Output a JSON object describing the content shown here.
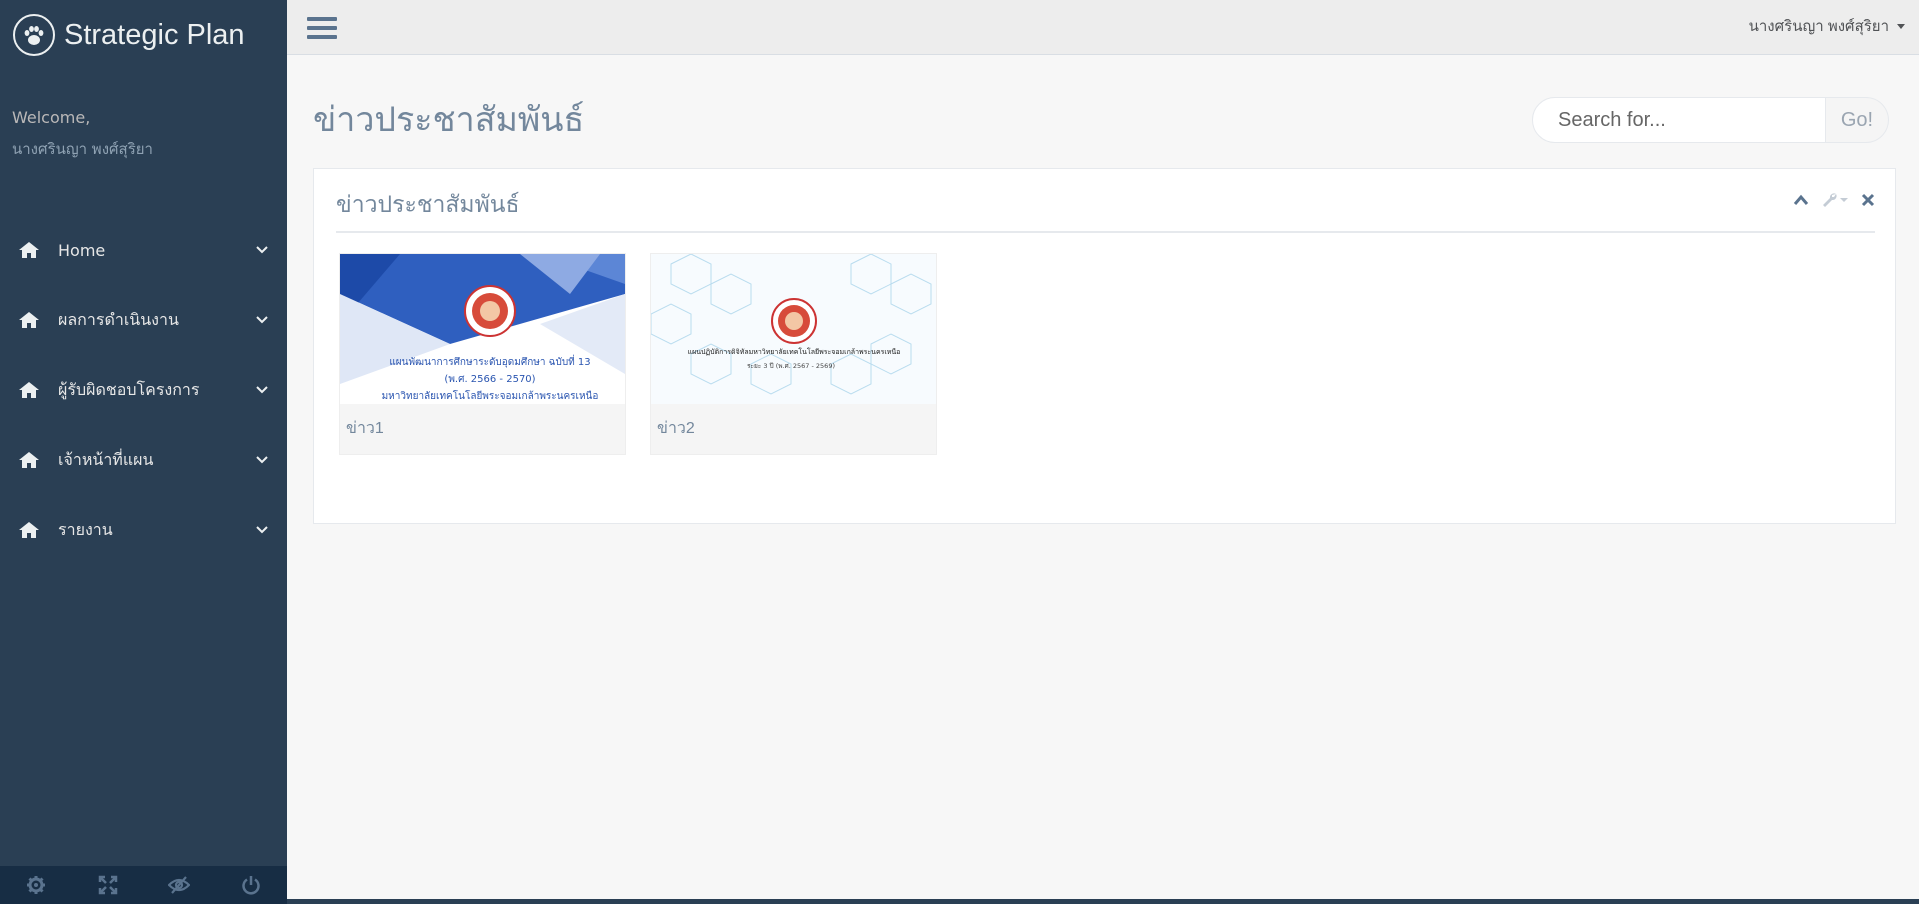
{
  "sidebar": {
    "brand_title": "Strategic Plan",
    "brand_icon": "paw-icon",
    "welcome_label": "Welcome,",
    "user_name": "นางศรินญา พงศ์สุริยา",
    "items": [
      {
        "label": "Home",
        "icon": "home-icon"
      },
      {
        "label": "ผลการดำเนินงาน",
        "icon": "home-icon"
      },
      {
        "label": "ผู้รับผิดชอบโครงการ",
        "icon": "home-icon"
      },
      {
        "label": "เจ้าหน้าที่แผน",
        "icon": "home-icon"
      },
      {
        "label": "รายงาน",
        "icon": "home-icon"
      }
    ],
    "footer": [
      "settings-icon",
      "fullscreen-icon",
      "lock-eye-icon",
      "power-icon"
    ]
  },
  "topbar": {
    "user_name": "นางศรินญา พงศ์สุริยา"
  },
  "main": {
    "page_title": "ข่าวประชาสัมพันธ์",
    "search": {
      "placeholder": "Search for...",
      "button": "Go!"
    },
    "panel": {
      "title": "ข่าวประชาสัมพันธ์",
      "cards": [
        {
          "caption": "ข่าว1",
          "thumb_lines": [
            "แผนพัฒนาการศึกษาระดับอุดมศึกษา ฉบับที่ 13",
            "(พ.ศ. 2566 - 2570)",
            "มหาวิทยาลัยเทคโนโลยีพระจอมเกล้าพระนครเหนือ"
          ]
        },
        {
          "caption": "ข่าว2",
          "thumb_lines": [
            "แผนปฏิบัติการดิจิทัลมหาวิทยาลัยเทคโนโลยีพระจอมเกล้าพระนครเหนือ",
            "ระยะ 3 ปี (พ.ศ. 2567 - 2569)"
          ]
        }
      ]
    }
  },
  "colors": {
    "sidebar_bg": "#2a3f54",
    "footer_bg": "#172d44",
    "title_text": "#73879c",
    "accent_blue": "#3a6bc4"
  }
}
